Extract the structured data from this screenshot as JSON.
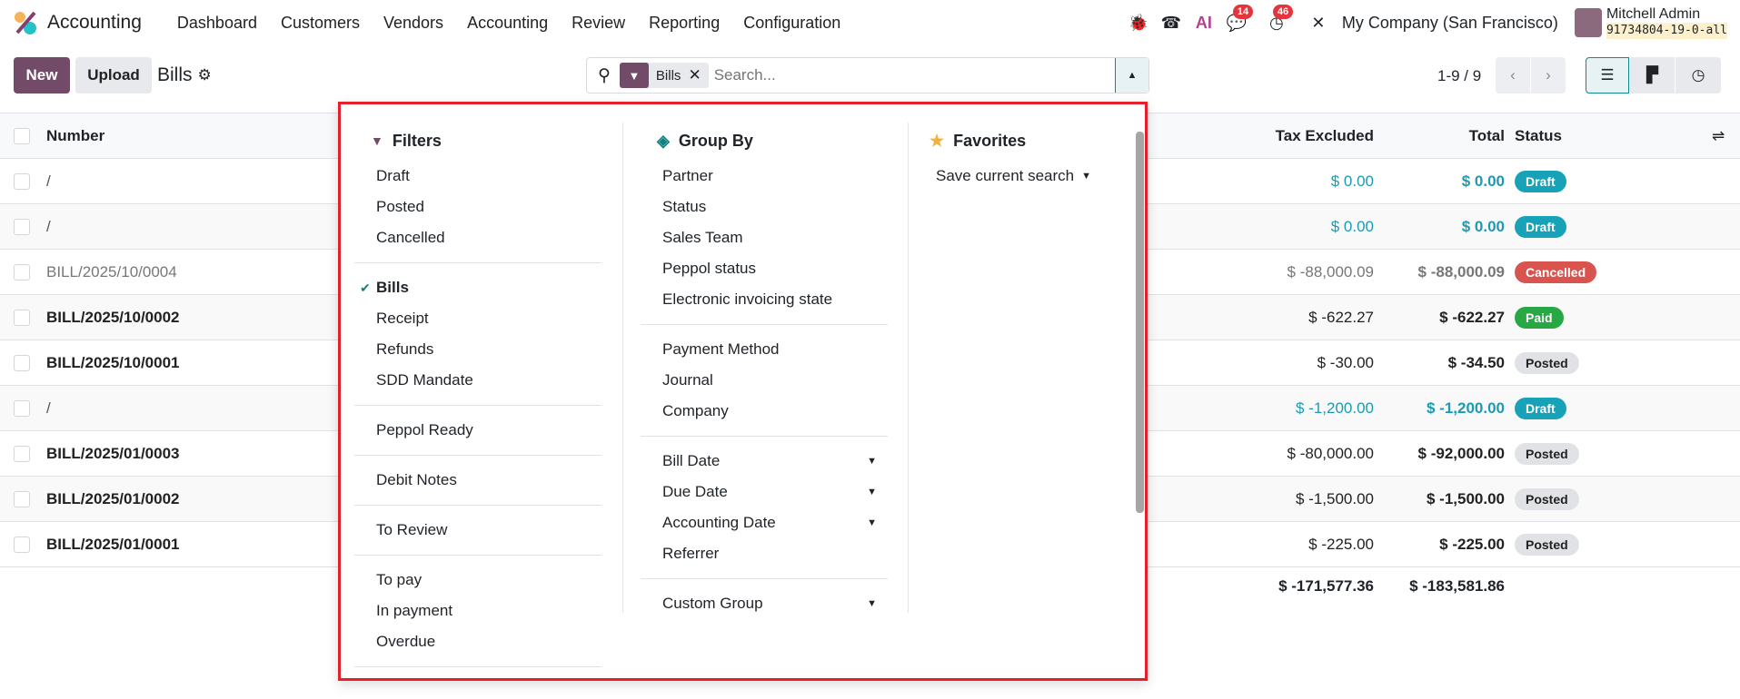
{
  "nav": {
    "app": "Accounting",
    "menu": [
      "Dashboard",
      "Customers",
      "Vendors",
      "Accounting",
      "Review",
      "Reporting",
      "Configuration"
    ],
    "messages_count": "14",
    "activities_count": "46",
    "company": "My Company (San Francisco)",
    "user": "Mitchell Admin",
    "db": "91734804-19-0-all"
  },
  "control": {
    "new": "New",
    "upload": "Upload",
    "title": "Bills",
    "facet": "Bills",
    "search_placeholder": "Search...",
    "pager": "1-9 / 9"
  },
  "table": {
    "headers": {
      "number": "Number",
      "tax": "Tax Excluded",
      "total": "Total",
      "status": "Status"
    },
    "rows": [
      {
        "number": "/",
        "tax": "$ 0.00",
        "total": "$ 0.00",
        "status": "Draft",
        "kind": "draft"
      },
      {
        "number": "/",
        "tax": "$ 0.00",
        "total": "$ 0.00",
        "status": "Draft",
        "kind": "draft"
      },
      {
        "number": "BILL/2025/10/0004",
        "tax": "$ -88,000.09",
        "total": "$ -88,000.09",
        "status": "Cancelled",
        "kind": "cancel"
      },
      {
        "number": "BILL/2025/10/0002",
        "tax": "$ -622.27",
        "total": "$ -622.27",
        "status": "Paid",
        "kind": "paid"
      },
      {
        "number": "BILL/2025/10/0001",
        "tax": "$ -30.00",
        "total": "$ -34.50",
        "status": "Posted",
        "kind": "posted"
      },
      {
        "number": "/",
        "tax": "$ -1,200.00",
        "total": "$ -1,200.00",
        "status": "Draft",
        "kind": "draft"
      },
      {
        "number": "BILL/2025/01/0003",
        "tax": "$ -80,000.00",
        "total": "$ -92,000.00",
        "status": "Posted",
        "kind": "posted"
      },
      {
        "number": "BILL/2025/01/0002",
        "tax": "$ -1,500.00",
        "total": "$ -1,500.00",
        "status": "Posted",
        "kind": "posted"
      },
      {
        "number": "BILL/2025/01/0001",
        "tax": "$ -225.00",
        "total": "$ -225.00",
        "status": "Posted",
        "kind": "posted"
      }
    ],
    "totals": {
      "tax": "$ -171,577.36",
      "total": "$ -183,581.86"
    }
  },
  "dropdown": {
    "filters": {
      "title": "Filters",
      "groups": [
        [
          "Draft",
          "Posted",
          "Cancelled"
        ],
        [
          "Bills",
          "Receipt",
          "Refunds",
          "SDD Mandate"
        ],
        [
          "Peppol Ready"
        ],
        [
          "Debit Notes"
        ],
        [
          "To Review"
        ],
        [
          "To pay",
          "In payment",
          "Overdue"
        ]
      ],
      "checked": "Bills"
    },
    "groupby": {
      "title": "Group By",
      "groups": [
        [
          "Partner",
          "Status",
          "Sales Team",
          "Peppol status",
          "Electronic invoicing state"
        ],
        [
          "Payment Method",
          "Journal",
          "Company"
        ],
        [
          "Bill Date",
          "Due Date",
          "Accounting Date",
          "Referrer"
        ],
        [
          "Custom Group"
        ]
      ],
      "with_caret": [
        "Bill Date",
        "Due Date",
        "Accounting Date",
        "Custom Group"
      ]
    },
    "favorites": {
      "title": "Favorites",
      "save": "Save current search"
    }
  },
  "colors": {
    "brand": "#714b67",
    "teal": "#1a9bb2",
    "draft": "#17a2b8",
    "cancel": "#d9534f",
    "paid": "#28a745",
    "posted": "#e0e2e6"
  }
}
